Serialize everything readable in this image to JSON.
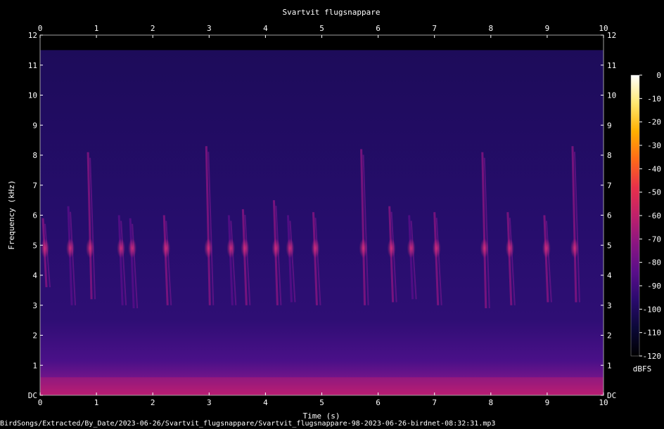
{
  "chart_data": {
    "type": "heatmap",
    "title": "Svartvit flugsnappare",
    "xlabel": "Time (s)",
    "ylabel": "Frequency (kHz)",
    "xlim": [
      0,
      10
    ],
    "ylim": [
      0,
      12
    ],
    "x_ticks": [
      "0",
      "1",
      "2",
      "3",
      "4",
      "5",
      "6",
      "7",
      "8",
      "9",
      "10"
    ],
    "y_ticks": [
      "DC",
      "1",
      "2",
      "3",
      "4",
      "5",
      "6",
      "7",
      "8",
      "9",
      "10",
      "11",
      "12"
    ],
    "colorbar": {
      "label": "dBFS",
      "range": [
        -120,
        0
      ],
      "ticks": [
        "0",
        "-10",
        "-20",
        "-30",
        "-40",
        "-50",
        "-60",
        "-70",
        "-80",
        "-90",
        "-100",
        "-110",
        "-120"
      ],
      "colormap": [
        "#000000",
        "#0b0838",
        "#2a0a6e",
        "#5a0e8a",
        "#8a1582",
        "#c0206a",
        "#e8304a",
        "#ff6a18",
        "#ffb000",
        "#ffe870",
        "#ffffff"
      ]
    },
    "background_color": "#000000",
    "noise_ceiling_khz": 11.5,
    "calls": [
      {
        "t": 0.05,
        "f_low": 3.6,
        "f_high": 5.9,
        "intensity": -72
      },
      {
        "t": 0.5,
        "f_low": 3.0,
        "f_high": 6.3,
        "intensity": -80
      },
      {
        "t": 0.85,
        "f_low": 3.2,
        "f_high": 8.1,
        "intensity": -68
      },
      {
        "t": 1.4,
        "f_low": 3.0,
        "f_high": 6.0,
        "intensity": -80
      },
      {
        "t": 1.6,
        "f_low": 2.9,
        "f_high": 5.9,
        "intensity": -82
      },
      {
        "t": 2.2,
        "f_low": 3.0,
        "f_high": 6.0,
        "intensity": -70
      },
      {
        "t": 2.95,
        "f_low": 3.0,
        "f_high": 8.3,
        "intensity": -68
      },
      {
        "t": 3.35,
        "f_low": 3.0,
        "f_high": 6.0,
        "intensity": -80
      },
      {
        "t": 3.6,
        "f_low": 3.0,
        "f_high": 6.2,
        "intensity": -75
      },
      {
        "t": 4.15,
        "f_low": 3.0,
        "f_high": 6.5,
        "intensity": -72
      },
      {
        "t": 4.4,
        "f_low": 3.1,
        "f_high": 6.0,
        "intensity": -82
      },
      {
        "t": 4.85,
        "f_low": 3.0,
        "f_high": 6.1,
        "intensity": -74
      },
      {
        "t": 5.7,
        "f_low": 3.0,
        "f_high": 8.2,
        "intensity": -70
      },
      {
        "t": 6.2,
        "f_low": 3.1,
        "f_high": 6.3,
        "intensity": -76
      },
      {
        "t": 6.55,
        "f_low": 3.2,
        "f_high": 6.0,
        "intensity": -80
      },
      {
        "t": 7.0,
        "f_low": 3.0,
        "f_high": 6.1,
        "intensity": -74
      },
      {
        "t": 7.85,
        "f_low": 2.9,
        "f_high": 8.1,
        "intensity": -70
      },
      {
        "t": 8.3,
        "f_low": 3.0,
        "f_high": 6.1,
        "intensity": -76
      },
      {
        "t": 8.95,
        "f_low": 3.1,
        "f_high": 6.0,
        "intensity": -74
      },
      {
        "t": 9.45,
        "f_low": 3.1,
        "f_high": 8.3,
        "intensity": -72
      }
    ]
  },
  "footer": {
    "file_path": "BirdSongs/Extracted/By_Date/2023-06-26/Svartvit_flugsnappare/Svartvit_flugsnappare-98-2023-06-26-birdnet-08:32:31.mp3"
  }
}
